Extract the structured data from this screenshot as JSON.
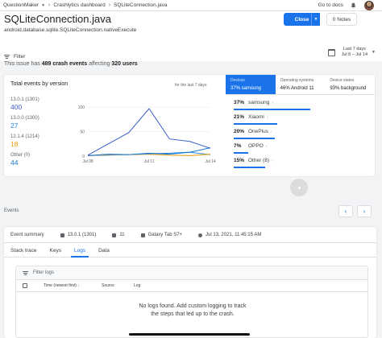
{
  "topbar": {
    "project": "QuestionMaker",
    "crumb1": "Crashlytics dashboard",
    "crumb2": "SQLiteConnection.java",
    "docs": "Go to docs"
  },
  "header": {
    "title": "SQLiteConnection.java",
    "subtitle": "android.database.sqlite.SQLiteConnection.nativeExecute",
    "close_label": "Close",
    "notes_label": "0 Notes",
    "filter_label": "Filter",
    "date_line1": "Last 7 days",
    "date_line2": "Jul 8 – Jul 14"
  },
  "summary": {
    "prefix": "This issue has",
    "crash_events": "489 crash events",
    "middle": "affecting",
    "users": "320 users"
  },
  "events_card": {
    "title": "Total events by version",
    "subtitle": "for the last 7 days",
    "versions": [
      {
        "label": "13.0.1 (1301)",
        "value": "400",
        "color": "#3b5ec7"
      },
      {
        "label": "13.0.0 (1300)",
        "value": "27",
        "color": "#1e88e5"
      },
      {
        "label": "12.1.4 (1214)",
        "value": "18",
        "color": "#f29900"
      },
      {
        "label": "Other (0)",
        "value": "44",
        "color": "#1976d2"
      }
    ]
  },
  "chart_data": {
    "type": "line",
    "title": "Total events by version",
    "x": [
      "Jul 08",
      "Jul 09",
      "Jul 10",
      "Jul 11",
      "Jul 12",
      "Jul 13",
      "Jul 14"
    ],
    "x_ticks": [
      "Jul 08",
      "Jul 11",
      "Jul 14"
    ],
    "y_ticks": [
      "0",
      "50",
      "100"
    ],
    "ylim": [
      0,
      120
    ],
    "series": [
      {
        "name": "13.0.1 (1301)",
        "color": "#3b5ec7",
        "values": [
          2,
          25,
          48,
          97,
          35,
          30,
          16
        ]
      },
      {
        "name": "13.0.0 (1300)",
        "color": "#1e88e5",
        "values": [
          1,
          2,
          3,
          6,
          4,
          8,
          3
        ]
      },
      {
        "name": "12.1.4 (1214)",
        "color": "#f29900",
        "values": [
          1,
          3,
          3,
          4,
          2,
          1,
          4
        ]
      },
      {
        "name": "Other (0)",
        "color": "#1976d2",
        "values": [
          1,
          4,
          3,
          5,
          6,
          8,
          17
        ]
      }
    ]
  },
  "breakdown": {
    "tabs": [
      {
        "header": "Devices",
        "value": "37% samsung"
      },
      {
        "header": "Operating systems",
        "value": "46% Android 11"
      },
      {
        "header": "Device states",
        "value": "93% background"
      }
    ],
    "items": [
      {
        "pct": "37%",
        "name": "samsung",
        "fraction": 0.37
      },
      {
        "pct": "21%",
        "name": "Xiaomi",
        "fraction": 0.21
      },
      {
        "pct": "20%",
        "name": "OnePlus",
        "fraction": 0.2
      },
      {
        "pct": "7%",
        "name": "OPPO",
        "fraction": 0.07
      },
      {
        "pct": "15%",
        "name": "Other (8)",
        "fraction": 0.15
      }
    ]
  },
  "events": {
    "label": "Events",
    "summary_label": "Event summary",
    "version": "13.0.1 (1301)",
    "android": "11",
    "device": "Galaxy Tab S7+",
    "time": "Jul 13, 2021, 11:45:15 AM",
    "tabs": [
      "Stack trace",
      "Keys",
      "Logs",
      "Data"
    ],
    "active_tab": "Logs",
    "filter_placeholder": "Filter logs",
    "col_time": "Time (newest first)",
    "col_source": "Source",
    "col_log": "Log",
    "empty_line1": "No logs found. Add custom logging to track",
    "empty_line2": "the steps that led up to the crash."
  }
}
